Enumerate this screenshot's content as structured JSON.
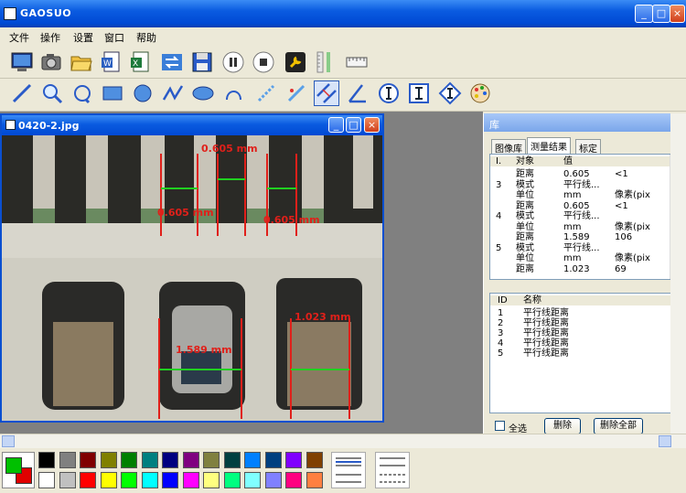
{
  "window": {
    "title": "GAOSUO",
    "btn_min": "_",
    "btn_max": "□",
    "btn_close": "×"
  },
  "menu": {
    "items": [
      "文件",
      "操作",
      "设置",
      "窗口",
      "帮助"
    ]
  },
  "image_window": {
    "title": "0420-2.jpg"
  },
  "measurements": [
    "0.605 mm",
    "0.605 mm",
    "0.605 mm",
    "1.023 mm",
    "1.589 mm"
  ],
  "library": {
    "title": "库",
    "tabs": [
      "图像库",
      "测量结果",
      "标定"
    ],
    "results_header": [
      "I.",
      "对象",
      "值"
    ],
    "results_rows": [
      [
        "",
        "距离",
        "0.605",
        "<1"
      ],
      [
        "3",
        "模式",
        "平行线...",
        ""
      ],
      [
        "",
        "单位",
        "mm",
        "像素(pix"
      ],
      [
        "",
        "距离",
        "0.605",
        "<1"
      ],
      [
        "4",
        "模式",
        "平行线...",
        ""
      ],
      [
        "",
        "单位",
        "mm",
        "像素(pix"
      ],
      [
        "",
        "距离",
        "1.589",
        "106"
      ],
      [
        "5",
        "模式",
        "平行线...",
        ""
      ],
      [
        "",
        "单位",
        "mm",
        "像素(pix"
      ],
      [
        "",
        "距离",
        "1.023",
        "69"
      ]
    ],
    "id_header": [
      "ID",
      "名称"
    ],
    "id_rows": [
      [
        "1",
        "平行线距离"
      ],
      [
        "2",
        "平行线距离"
      ],
      [
        "3",
        "平行线距离"
      ],
      [
        "4",
        "平行线距离"
      ],
      [
        "5",
        "平行线距离"
      ]
    ],
    "select_all": "全选",
    "delete": "删除",
    "delete_all": "删除全部"
  },
  "palette": {
    "colors_top": [
      "#000000",
      "#808080",
      "#800000",
      "#808000",
      "#008000",
      "#008080",
      "#000080",
      "#800080",
      "#808040",
      "#004040",
      "#0080ff",
      "#004080",
      "#8000ff",
      "#804000"
    ],
    "colors_bottom": [
      "#ffffff",
      "#c0c0c0",
      "#ff0000",
      "#ffff00",
      "#00ff00",
      "#00ffff",
      "#0000ff",
      "#ff00ff",
      "#ffff80",
      "#00ff80",
      "#80ffff",
      "#8080ff",
      "#ff0080",
      "#ff8040"
    ]
  }
}
